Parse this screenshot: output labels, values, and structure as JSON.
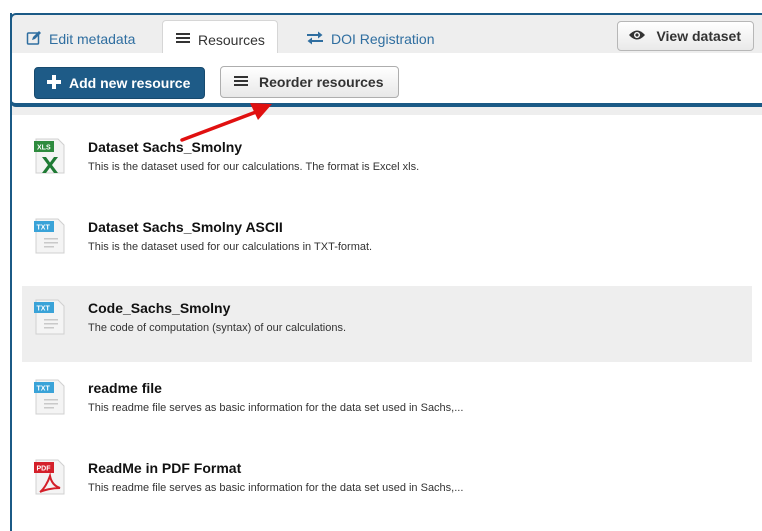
{
  "tabs": {
    "edit_metadata": "Edit metadata",
    "resources": "Resources",
    "doi_registration": "DOI Registration"
  },
  "view_dataset_label": "View dataset",
  "toolbar": {
    "add_label": "Add new resource",
    "reorder_label": "Reorder resources"
  },
  "resources": [
    {
      "title": "Dataset Sachs_Smolny",
      "description": "This is the dataset used for our calculations. The format is Excel xls.",
      "format": "XLS",
      "icon": "excel-file-icon",
      "highlighted": false
    },
    {
      "title": "Dataset Sachs_Smolny ASCII",
      "description": "This is the dataset used for our calculations in TXT-format.",
      "format": "TXT",
      "icon": "text-file-icon",
      "highlighted": false
    },
    {
      "title": "Code_Sachs_Smolny",
      "description": "The code of computation (syntax) of our calculations.",
      "format": "TXT",
      "icon": "text-file-icon",
      "highlighted": true
    },
    {
      "title": "readme file",
      "description": "This readme file serves as basic information for the data set used in Sachs,...",
      "format": "TXT",
      "icon": "text-file-icon",
      "highlighted": false
    },
    {
      "title": "ReadMe in PDF Format",
      "description": "This readme file serves as basic information for the data set used in Sachs,...",
      "format": "PDF",
      "icon": "pdf-file-icon",
      "highlighted": false
    }
  ],
  "colors": {
    "accent": "#1b5a86",
    "link": "#2f6ea0",
    "annotation_arrow": "#e01010"
  }
}
